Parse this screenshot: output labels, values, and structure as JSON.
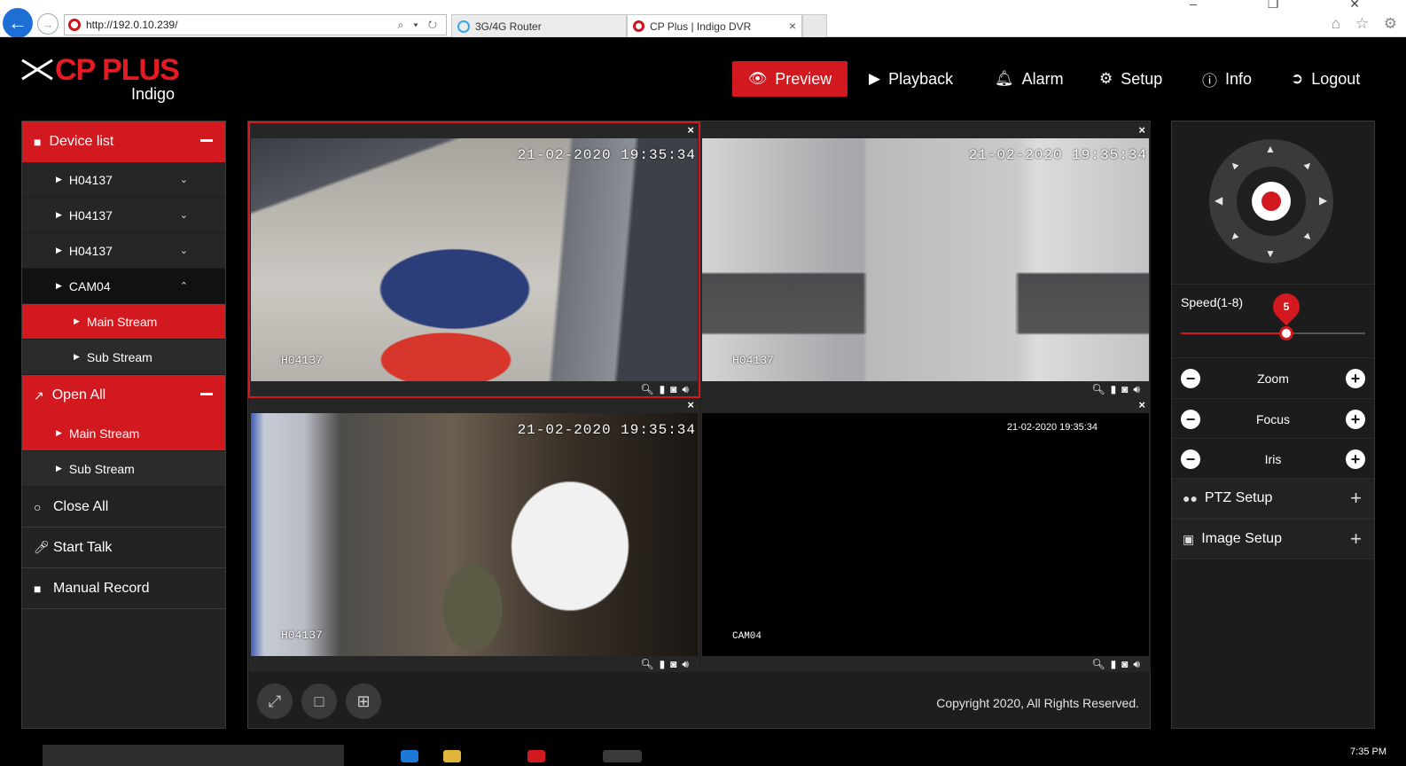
{
  "browser": {
    "address": "http://192.0.10.239/",
    "address_tools": "⌕ ▾ ↻",
    "tabs": [
      {
        "label": "3G/4G Router"
      },
      {
        "label": "CP Plus | Indigo DVR"
      }
    ],
    "tab_close": "×",
    "window_controls": "– ❐ ✕",
    "toolbar_icons": "⌂ ☆ ⚙"
  },
  "logo": {
    "brand": "CP PLUS",
    "sub": "Indigo"
  },
  "nav": {
    "preview": "Preview",
    "playback": "Playback",
    "alarm": "Alarm",
    "setup": "Setup",
    "info": "Info",
    "logout": "Logout",
    "active": "Preview"
  },
  "sidebar": {
    "device_list": "Device list",
    "devices": [
      {
        "label": "H04137"
      },
      {
        "label": "H04137"
      },
      {
        "label": "H04137"
      },
      {
        "label": "CAM04"
      }
    ],
    "cam04_streams": [
      "Main Stream",
      "Sub Stream"
    ],
    "open_all": "Open All",
    "open_all_streams": [
      "Main Stream",
      "Sub Stream"
    ],
    "close_all": "Close All",
    "start_talk": "Start Talk",
    "manual_record": "Manual Record"
  },
  "cells": [
    {
      "timestamp": "21-02-2020 19:35:34",
      "label": "H04137",
      "selected": true
    },
    {
      "timestamp": "21-02-2020 19:35:34",
      "label": "H04137",
      "selected": false
    },
    {
      "timestamp": "21-02-2020 19:35:34",
      "label": "H04137",
      "selected": false
    },
    {
      "timestamp": "21-02-2020 19:35:34",
      "label": "CAM04",
      "selected": false
    }
  ],
  "cell_close": "×",
  "cell_tools": "🔍︎▮◙🔊︎",
  "footer": {
    "copyright": "Copyright 2020, All Rights Reserved."
  },
  "ptz": {
    "speed_label": "Speed(1-8)",
    "speed_value": "5",
    "speed_min": 1,
    "speed_max": 8,
    "zoom": "Zoom",
    "focus": "Focus",
    "iris": "Iris",
    "ptz_setup": "PTZ Setup",
    "image_setup": "Image Setup"
  },
  "taskbar": {
    "clock": "7:35 PM"
  },
  "colors": {
    "accent": "#d31920",
    "panel": "#222222",
    "background": "#000000"
  }
}
